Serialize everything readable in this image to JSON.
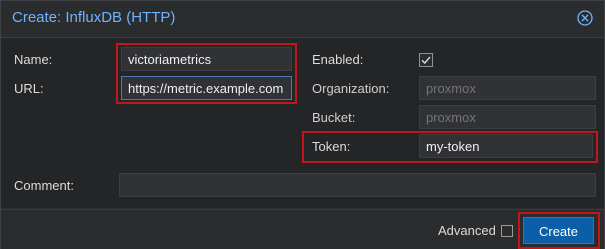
{
  "dialog": {
    "title": "Create: InfluxDB (HTTP)",
    "close_icon": "close-circle-icon"
  },
  "form": {
    "name": {
      "label": "Name:",
      "value": "victoriametrics"
    },
    "url": {
      "label": "URL:",
      "value": "https://metric.example.com"
    },
    "enabled": {
      "label": "Enabled:",
      "checked": true
    },
    "organization": {
      "label": "Organization:",
      "placeholder": "proxmox"
    },
    "bucket": {
      "label": "Bucket:",
      "placeholder": "proxmox"
    },
    "token": {
      "label": "Token:",
      "value": "my-token"
    },
    "comment": {
      "label": "Comment:",
      "value": ""
    }
  },
  "footer": {
    "advanced_label": "Advanced",
    "advanced_checked": false,
    "create_label": "Create"
  },
  "colors": {
    "accent": "#6fb2ff",
    "primary_button": "#0b5fa8",
    "highlight_box": "#c4141c"
  }
}
